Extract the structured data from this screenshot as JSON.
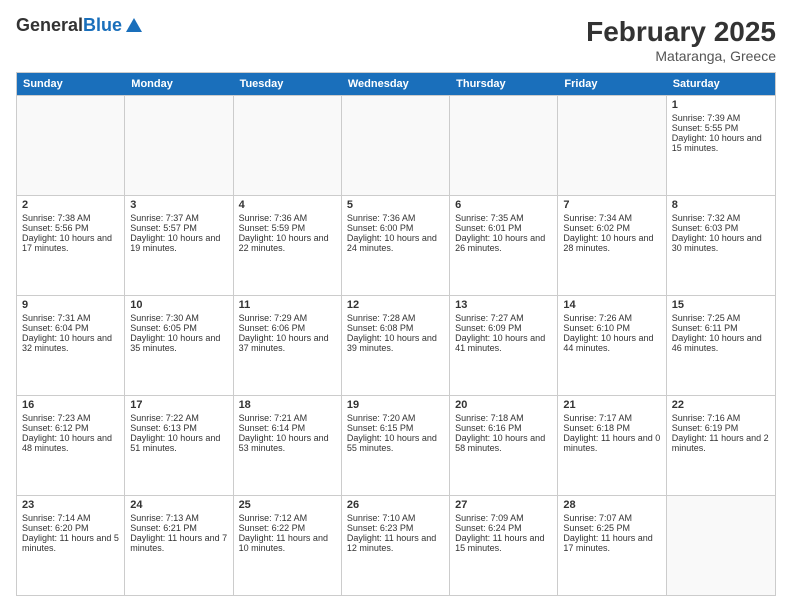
{
  "header": {
    "logo_general": "General",
    "logo_blue": "Blue",
    "month_year": "February 2025",
    "location": "Mataranga, Greece"
  },
  "days_of_week": [
    "Sunday",
    "Monday",
    "Tuesday",
    "Wednesday",
    "Thursday",
    "Friday",
    "Saturday"
  ],
  "weeks": [
    [
      {
        "day": "",
        "info": ""
      },
      {
        "day": "",
        "info": ""
      },
      {
        "day": "",
        "info": ""
      },
      {
        "day": "",
        "info": ""
      },
      {
        "day": "",
        "info": ""
      },
      {
        "day": "",
        "info": ""
      },
      {
        "day": "1",
        "sunrise": "Sunrise: 7:39 AM",
        "sunset": "Sunset: 5:55 PM",
        "daylight": "Daylight: 10 hours and 15 minutes."
      }
    ],
    [
      {
        "day": "2",
        "sunrise": "Sunrise: 7:38 AM",
        "sunset": "Sunset: 5:56 PM",
        "daylight": "Daylight: 10 hours and 17 minutes."
      },
      {
        "day": "3",
        "sunrise": "Sunrise: 7:37 AM",
        "sunset": "Sunset: 5:57 PM",
        "daylight": "Daylight: 10 hours and 19 minutes."
      },
      {
        "day": "4",
        "sunrise": "Sunrise: 7:36 AM",
        "sunset": "Sunset: 5:59 PM",
        "daylight": "Daylight: 10 hours and 22 minutes."
      },
      {
        "day": "5",
        "sunrise": "Sunrise: 7:36 AM",
        "sunset": "Sunset: 6:00 PM",
        "daylight": "Daylight: 10 hours and 24 minutes."
      },
      {
        "day": "6",
        "sunrise": "Sunrise: 7:35 AM",
        "sunset": "Sunset: 6:01 PM",
        "daylight": "Daylight: 10 hours and 26 minutes."
      },
      {
        "day": "7",
        "sunrise": "Sunrise: 7:34 AM",
        "sunset": "Sunset: 6:02 PM",
        "daylight": "Daylight: 10 hours and 28 minutes."
      },
      {
        "day": "8",
        "sunrise": "Sunrise: 7:32 AM",
        "sunset": "Sunset: 6:03 PM",
        "daylight": "Daylight: 10 hours and 30 minutes."
      }
    ],
    [
      {
        "day": "9",
        "sunrise": "Sunrise: 7:31 AM",
        "sunset": "Sunset: 6:04 PM",
        "daylight": "Daylight: 10 hours and 32 minutes."
      },
      {
        "day": "10",
        "sunrise": "Sunrise: 7:30 AM",
        "sunset": "Sunset: 6:05 PM",
        "daylight": "Daylight: 10 hours and 35 minutes."
      },
      {
        "day": "11",
        "sunrise": "Sunrise: 7:29 AM",
        "sunset": "Sunset: 6:06 PM",
        "daylight": "Daylight: 10 hours and 37 minutes."
      },
      {
        "day": "12",
        "sunrise": "Sunrise: 7:28 AM",
        "sunset": "Sunset: 6:08 PM",
        "daylight": "Daylight: 10 hours and 39 minutes."
      },
      {
        "day": "13",
        "sunrise": "Sunrise: 7:27 AM",
        "sunset": "Sunset: 6:09 PM",
        "daylight": "Daylight: 10 hours and 41 minutes."
      },
      {
        "day": "14",
        "sunrise": "Sunrise: 7:26 AM",
        "sunset": "Sunset: 6:10 PM",
        "daylight": "Daylight: 10 hours and 44 minutes."
      },
      {
        "day": "15",
        "sunrise": "Sunrise: 7:25 AM",
        "sunset": "Sunset: 6:11 PM",
        "daylight": "Daylight: 10 hours and 46 minutes."
      }
    ],
    [
      {
        "day": "16",
        "sunrise": "Sunrise: 7:23 AM",
        "sunset": "Sunset: 6:12 PM",
        "daylight": "Daylight: 10 hours and 48 minutes."
      },
      {
        "day": "17",
        "sunrise": "Sunrise: 7:22 AM",
        "sunset": "Sunset: 6:13 PM",
        "daylight": "Daylight: 10 hours and 51 minutes."
      },
      {
        "day": "18",
        "sunrise": "Sunrise: 7:21 AM",
        "sunset": "Sunset: 6:14 PM",
        "daylight": "Daylight: 10 hours and 53 minutes."
      },
      {
        "day": "19",
        "sunrise": "Sunrise: 7:20 AM",
        "sunset": "Sunset: 6:15 PM",
        "daylight": "Daylight: 10 hours and 55 minutes."
      },
      {
        "day": "20",
        "sunrise": "Sunrise: 7:18 AM",
        "sunset": "Sunset: 6:16 PM",
        "daylight": "Daylight: 10 hours and 58 minutes."
      },
      {
        "day": "21",
        "sunrise": "Sunrise: 7:17 AM",
        "sunset": "Sunset: 6:18 PM",
        "daylight": "Daylight: 11 hours and 0 minutes."
      },
      {
        "day": "22",
        "sunrise": "Sunrise: 7:16 AM",
        "sunset": "Sunset: 6:19 PM",
        "daylight": "Daylight: 11 hours and 2 minutes."
      }
    ],
    [
      {
        "day": "23",
        "sunrise": "Sunrise: 7:14 AM",
        "sunset": "Sunset: 6:20 PM",
        "daylight": "Daylight: 11 hours and 5 minutes."
      },
      {
        "day": "24",
        "sunrise": "Sunrise: 7:13 AM",
        "sunset": "Sunset: 6:21 PM",
        "daylight": "Daylight: 11 hours and 7 minutes."
      },
      {
        "day": "25",
        "sunrise": "Sunrise: 7:12 AM",
        "sunset": "Sunset: 6:22 PM",
        "daylight": "Daylight: 11 hours and 10 minutes."
      },
      {
        "day": "26",
        "sunrise": "Sunrise: 7:10 AM",
        "sunset": "Sunset: 6:23 PM",
        "daylight": "Daylight: 11 hours and 12 minutes."
      },
      {
        "day": "27",
        "sunrise": "Sunrise: 7:09 AM",
        "sunset": "Sunset: 6:24 PM",
        "daylight": "Daylight: 11 hours and 15 minutes."
      },
      {
        "day": "28",
        "sunrise": "Sunrise: 7:07 AM",
        "sunset": "Sunset: 6:25 PM",
        "daylight": "Daylight: 11 hours and 17 minutes."
      },
      {
        "day": "",
        "info": ""
      }
    ]
  ]
}
